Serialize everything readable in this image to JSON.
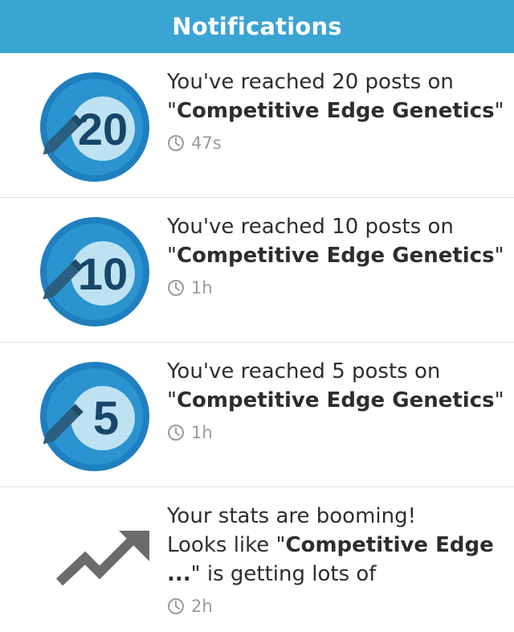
{
  "header": {
    "title": "Notifications"
  },
  "notifications": [
    {
      "badge_number": "20",
      "line1": "You've reached 20 posts on",
      "quote_open": "\"",
      "bold": "Competitive Edge Genetics",
      "quote_close": "\"",
      "time": "47s",
      "icon": "pencil-milestone-badge"
    },
    {
      "badge_number": "10",
      "line1": "You've reached 10 posts on",
      "quote_open": "\"",
      "bold": "Competitive Edge Genetics",
      "quote_close": "\"",
      "time": "1h",
      "icon": "pencil-milestone-badge"
    },
    {
      "badge_number": "5",
      "line1": "You've reached 5 posts on",
      "quote_open": "\"",
      "bold": "Competitive Edge Genetics",
      "quote_close": "\"",
      "time": "1h",
      "icon": "pencil-milestone-badge"
    },
    {
      "line1": "Your stats are booming!",
      "pre": "Looks like \"",
      "bold": "Competitive Edge ...",
      "post": "\" is getting lots of",
      "time": "2h",
      "icon": "trending-up-arrow-icon"
    }
  ],
  "colors": {
    "header": "#3aa4d3",
    "badge_outer": "#1f8ac4",
    "badge_inner": "#bfe2f2",
    "text": "#2d2d2d",
    "time": "#9a9a9a",
    "trend": "#6b6b6b"
  }
}
